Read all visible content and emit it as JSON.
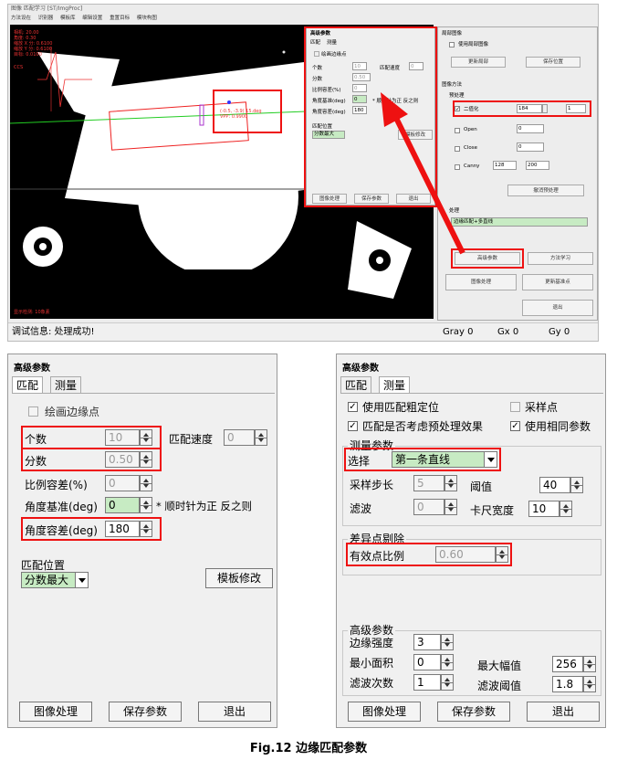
{
  "top": {
    "title": "图像 匹配学习 [ST/ImgProc]",
    "menu": [
      "方法设在",
      "识别器",
      "模板库",
      "编辑设置",
      "重置目标",
      "模块构图"
    ],
    "overlay_topleft": [
      "相机: 20.00",
      "角度: 0.30",
      "缩放 X 分: 0.6100",
      "缩放 Y 分: 0.6100",
      "目标: 0.0100"
    ],
    "overlay_side": "CCS",
    "overlay_bottom": "显示检测: 10象素",
    "match_text": [
      "(-0.5, -3.9) 15.deg",
      "VPP: 0.9900"
    ],
    "status": "调试信息: 处理成功!",
    "status_gray": "Gray 0",
    "status_gx": "Gx 0",
    "status_gy": "Gy 0",
    "right_panel": {
      "local_title": "局部图像",
      "use_local": "使用局部图像",
      "btn_update_local": "更新局部",
      "btn_save_pos": "保存位置",
      "method_title": "图像方法",
      "preprocess_title": "预处理",
      "binarize": "二值化",
      "binarize_v1": "184",
      "binarize_v2": "1",
      "open_lbl": "Open",
      "open_v": "0",
      "close_lbl": "Close",
      "close_v": "0",
      "canny_lbl": "Canny",
      "canny_v1": "128",
      "canny_v2": "200",
      "btn_cancel_pre": "撤消预处理",
      "postprocess_title": "处理",
      "post_select": "边缘匹配+多直线",
      "btn_advanced": "高级参数",
      "btn_method_learn": "方法学习",
      "btn_image_proc": "图像处理",
      "btn_update_base": "更新基准点",
      "btn_exit": "退出"
    },
    "mini_dialog": {
      "title": "高级参数",
      "tab1": "匹配",
      "tab2": "测量",
      "draw_edge": "绘画边缘点",
      "count": "个数",
      "count_v": "10",
      "score": "分数",
      "score_v": "0.50",
      "ratio": "比例容差(%)",
      "ratio_v": "0",
      "angle_base": "角度基准(deg)",
      "angle_base_v": "0",
      "angle_tol": "角度容差(deg)",
      "angle_tol_v": "180",
      "speed": "匹配速度",
      "speed_v": "0",
      "note": "* 顺时针为正 反之则",
      "pos": "匹配位置",
      "pos_v": "分数最大",
      "btn_tmpl": "模板修改",
      "btn_img": "图像处理",
      "btn_save": "保存参数",
      "btn_exit": "退出"
    }
  },
  "left_dlg": {
    "title": "高级参数",
    "tab1": "匹配",
    "tab2": "测量",
    "draw_edge": "绘画边缘点",
    "count_label": "个数",
    "count_value": "10",
    "speed_label": "匹配速度",
    "speed_value": "0",
    "score_label": "分数",
    "score_value": "0.50",
    "ratio_label": "比例容差(%)",
    "ratio_value": "0",
    "angle_base_label": "角度基准(deg)",
    "angle_base_value": "0",
    "note": "* 顺时针为正 反之则",
    "angle_tol_label": "角度容差(deg)",
    "angle_tol_value": "180",
    "pos_label": "匹配位置",
    "pos_value": "分数最大",
    "btn_template": "模板修改",
    "btn_image": "图像处理",
    "btn_save": "保存参数",
    "btn_exit": "退出"
  },
  "right_dlg": {
    "title": "高级参数",
    "tab1": "匹配",
    "tab2": "测量",
    "chk_coarse": "使用匹配粗定位",
    "chk_sample": "采样点",
    "chk_preproc": "匹配是否考虑预处理效果",
    "chk_same": "使用相同参数",
    "measure_group": "测量参数",
    "select_label": "选择",
    "select_value": "第一条直线",
    "step_label": "采样步长",
    "step_value": "5",
    "threshold_label": "阈值",
    "threshold_value": "40",
    "filter_label": "滤波",
    "filter_value": "0",
    "caliper_label": "卡尺宽度",
    "caliper_value": "10",
    "outlier_group": "差异点剔除",
    "valid_ratio_label": "有效点比例",
    "valid_ratio_value": "0.60",
    "adv_group": "高级参数",
    "edge_strength_label": "边缘强度",
    "edge_strength_value": "3",
    "min_area_label": "最小面积",
    "min_area_value": "0",
    "max_amp_label": "最大幅值",
    "max_amp_value": "256",
    "filter_times_label": "滤波次数",
    "filter_times_value": "1",
    "filter_thresh_label": "滤波阈值",
    "filter_thresh_value": "1.8",
    "btn_image": "图像处理",
    "btn_save": "保存参数",
    "btn_exit": "退出"
  },
  "caption": "Fig.12  边缘匹配参数"
}
